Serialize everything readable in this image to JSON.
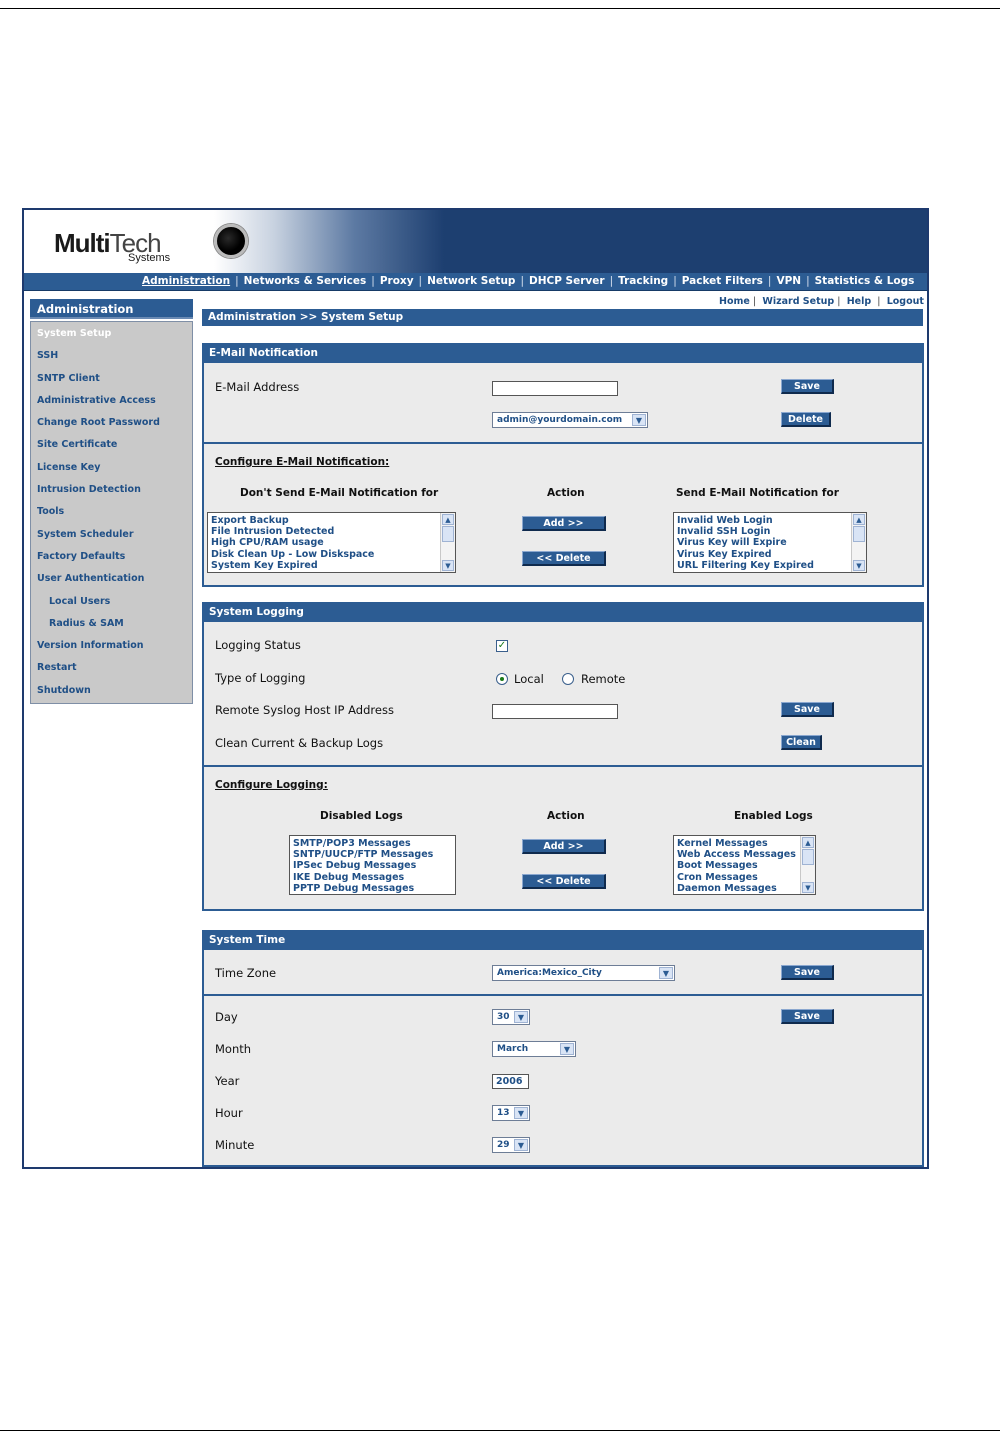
{
  "logo": {
    "brand_bold": "Multi",
    "brand_light": "Tech",
    "sub": "Systems"
  },
  "topnav": [
    {
      "label": "Administration"
    },
    {
      "label": "Networks & Services"
    },
    {
      "label": "Proxy"
    },
    {
      "label": "Network Setup"
    },
    {
      "label": "DHCP Server"
    },
    {
      "label": "Tracking"
    },
    {
      "label": "Packet Filters"
    },
    {
      "label": "VPN"
    },
    {
      "label": "Statistics & Logs"
    }
  ],
  "sidebar": {
    "title": "Administration",
    "items": [
      {
        "label": "System Setup"
      },
      {
        "label": "SSH"
      },
      {
        "label": "SNTP Client"
      },
      {
        "label": "Administrative Access"
      },
      {
        "label": "Change Root Password"
      },
      {
        "label": "Site Certificate"
      },
      {
        "label": "License Key"
      },
      {
        "label": "Intrusion Detection"
      },
      {
        "label": "Tools"
      },
      {
        "label": "System Scheduler"
      },
      {
        "label": "Factory Defaults"
      },
      {
        "label": "User Authentication"
      },
      {
        "label": "Local Users"
      },
      {
        "label": "Radius & SAM"
      },
      {
        "label": "Version Information"
      },
      {
        "label": "Restart"
      },
      {
        "label": "Shutdown"
      }
    ]
  },
  "toplinks": {
    "home": "Home",
    "wizard": "Wizard Setup",
    "help": "Help",
    "logout": "Logout"
  },
  "breadcrumb": "Administration >> System Setup",
  "email": {
    "title": "E-Mail Notification",
    "address_label": "E-Mail Address",
    "address_value": "",
    "save": "Save",
    "selected_address": "admin@yourdomain.com",
    "delete": "Delete",
    "configure_label": "Configure E-Mail Notification:",
    "dont_send_head": "Don't Send E-Mail Notification for",
    "action_head": "Action",
    "send_head": "Send E-Mail Notification for",
    "dont_send_items": [
      "Export Backup",
      "File Intrusion Detected",
      "High CPU/RAM usage",
      "Disk Clean Up - Low Diskspace",
      "System Key Expired"
    ],
    "send_items": [
      "Invalid Web Login",
      "Invalid SSH Login",
      "Virus Key will Expire",
      "Virus Key Expired",
      "URL Filtering Key Expired"
    ],
    "add": "Add  >>",
    "remove": "<<  Delete"
  },
  "logging": {
    "title": "System Logging",
    "status_label": "Logging Status",
    "status_checked": true,
    "check_mark": "✓",
    "type_label": "Type of Logging",
    "type_local": "Local",
    "type_remote": "Remote",
    "host_label": "Remote Syslog Host IP Address",
    "host_value": "",
    "save": "Save",
    "clean_label": "Clean Current & Backup Logs",
    "clean": "Clean",
    "configure_label": "Configure Logging:",
    "disabled_head": "Disabled Logs",
    "action_head": "Action",
    "enabled_head": "Enabled Logs",
    "disabled_items": [
      "SMTP/POP3 Messages",
      "SNTP/UUCP/FTP Messages",
      "IPSec Debug Messages",
      "IKE Debug Messages",
      "PPTP Debug Messages"
    ],
    "enabled_items": [
      "Kernel Messages",
      "Web Access Messages",
      "Boot Messages",
      "Cron Messages",
      "Daemon Messages"
    ],
    "add": "Add  >>",
    "remove": "<<  Delete"
  },
  "time": {
    "title": "System Time",
    "zone_label": "Time Zone",
    "zone_value": "America:Mexico_City",
    "save": "Save",
    "day_label": "Day",
    "day_value": "30",
    "month_label": "Month",
    "month_value": "March",
    "year_label": "Year",
    "year_value": "2006",
    "hour_label": "Hour",
    "hour_value": "13",
    "minute_label": "Minute",
    "minute_value": "29"
  },
  "colors": {
    "nav_blue": "#2c5c93",
    "panel_bg": "#ebebeb",
    "sidebar_bg": "#c9c9c9",
    "link_blue": "#1f4f86"
  },
  "icons": {
    "dropdown": "chevron-down-icon",
    "scroll_up": "scroll-up-icon",
    "scroll_down": "scroll-down-icon"
  }
}
